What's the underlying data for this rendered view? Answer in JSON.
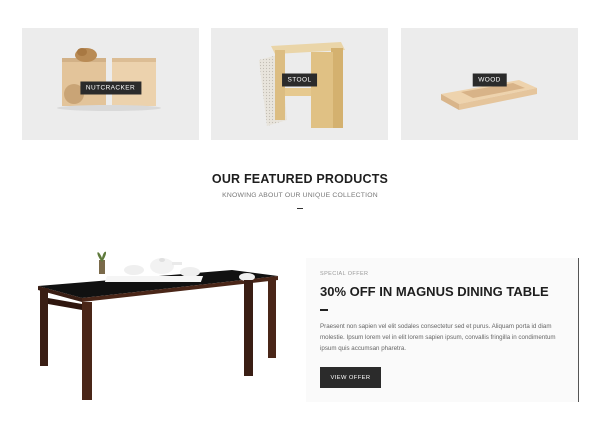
{
  "categories": [
    {
      "label": "NUTCRACKER"
    },
    {
      "label": "STOOL"
    },
    {
      "label": "WOOD"
    }
  ],
  "featured": {
    "title": "OUR FEATURED PRODUCTS",
    "subtitle": "KNOWING ABOUT OUR UNIQUE COLLECTION"
  },
  "offer": {
    "kicker": "SPECIAL OFFER",
    "title": "30% OFF IN MAGNUS DINING TABLE",
    "description": "Praesent non sapien vel elit sodales consectetur sed et purus. Aliquam porta id diam molestie. Ipsum lorem vel in elit lorem sapien ipsum, convallis fringilla in condimentum ipsum quis accumsan pharetra.",
    "button_label": "VIEW OFFER"
  }
}
